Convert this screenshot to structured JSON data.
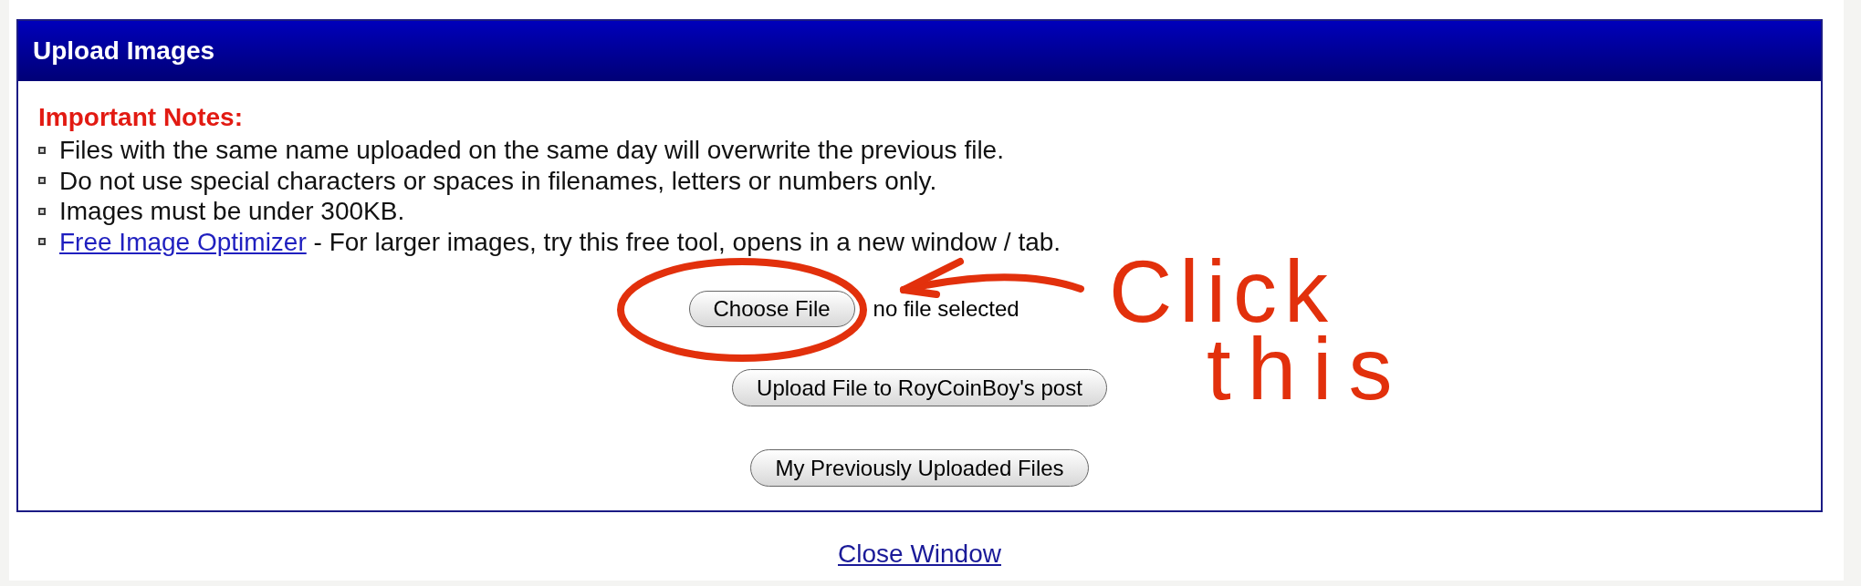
{
  "window": {
    "title": "Upload Images"
  },
  "notes": {
    "heading": "Important Notes:",
    "items": [
      {
        "kind": "text",
        "text": "Files with the same name uploaded on the same day will overwrite the previous file."
      },
      {
        "kind": "text",
        "text": "Do not use special characters or spaces in filenames, letters or numbers only."
      },
      {
        "kind": "text",
        "text": "Images must be under 300KB."
      },
      {
        "kind": "link",
        "link": "Free Image Optimizer",
        "text": " - For larger images, try this free tool, opens in a new window / tab."
      }
    ]
  },
  "file_input": {
    "button": "Choose File",
    "status": "no file selected"
  },
  "buttons": [
    "Upload File to RoyCoinBoy's post",
    "My Previously Uploaded Files"
  ],
  "footer_link": "Close Window",
  "annotation": {
    "lines": [
      "Click",
      "this"
    ]
  }
}
